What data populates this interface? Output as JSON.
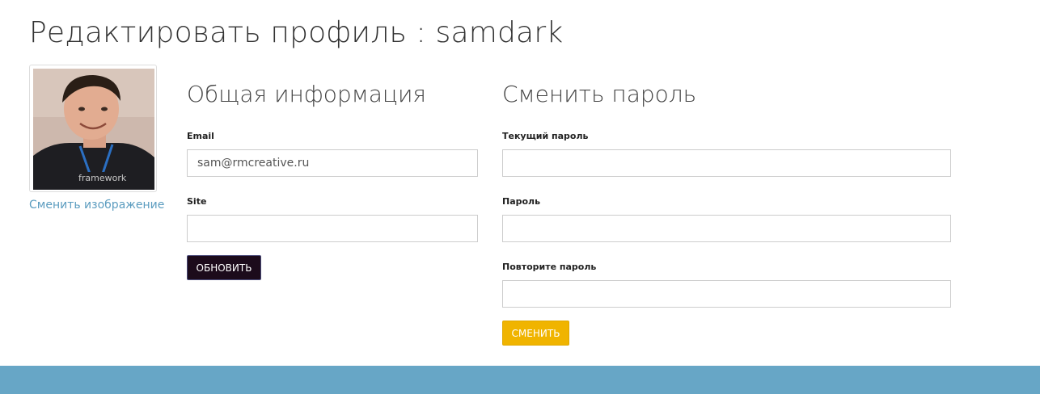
{
  "page": {
    "title": "Редактировать профиль : samdark"
  },
  "profile": {
    "avatar_alt": "samdark avatar",
    "change_image_link": "Сменить изображение"
  },
  "general": {
    "title": "Общая информация",
    "email": {
      "label": "Email",
      "value": "sam@rmcreative.ru"
    },
    "site": {
      "label": "Site",
      "value": ""
    },
    "update_button": "Обновить"
  },
  "password": {
    "title": "Сменить пароль",
    "current": {
      "label": "Текущий пароль",
      "value": ""
    },
    "new": {
      "label": "Пароль",
      "value": ""
    },
    "repeat": {
      "label": "Повторите пароль",
      "value": ""
    },
    "change_button": "Сменить"
  },
  "colors": {
    "link": "#5b9cbf",
    "update_button_bg": "#1c0b1b",
    "change_button_bg": "#f0b400",
    "footer_bg": "#67a6c6"
  }
}
